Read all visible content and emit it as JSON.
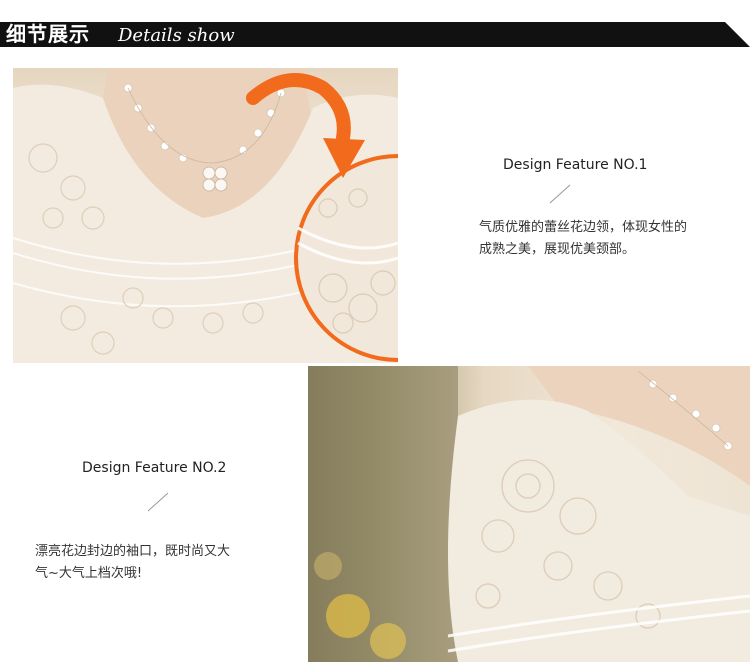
{
  "header": {
    "title_cn": "细节展示",
    "title_en": "Details show"
  },
  "features": [
    {
      "title": "Design Feature NO.1",
      "text_line1": "气质优雅的蕾丝花边领，体现女性的",
      "text_line2": "成熟之美，展现优美颈部。"
    },
    {
      "title": "Design Feature NO.2",
      "text_line1": "漂亮花边封边的袖口，既时尚又大",
      "text_line2": "气~大气上档次哦!"
    }
  ],
  "colors": {
    "header_bg": "#111111",
    "arrow": "#f26a1b",
    "magnifier_ring": "#f26a1b"
  },
  "icons": {
    "arrow": "curved-arrow-icon",
    "magnifier": "magnifier-circle"
  }
}
